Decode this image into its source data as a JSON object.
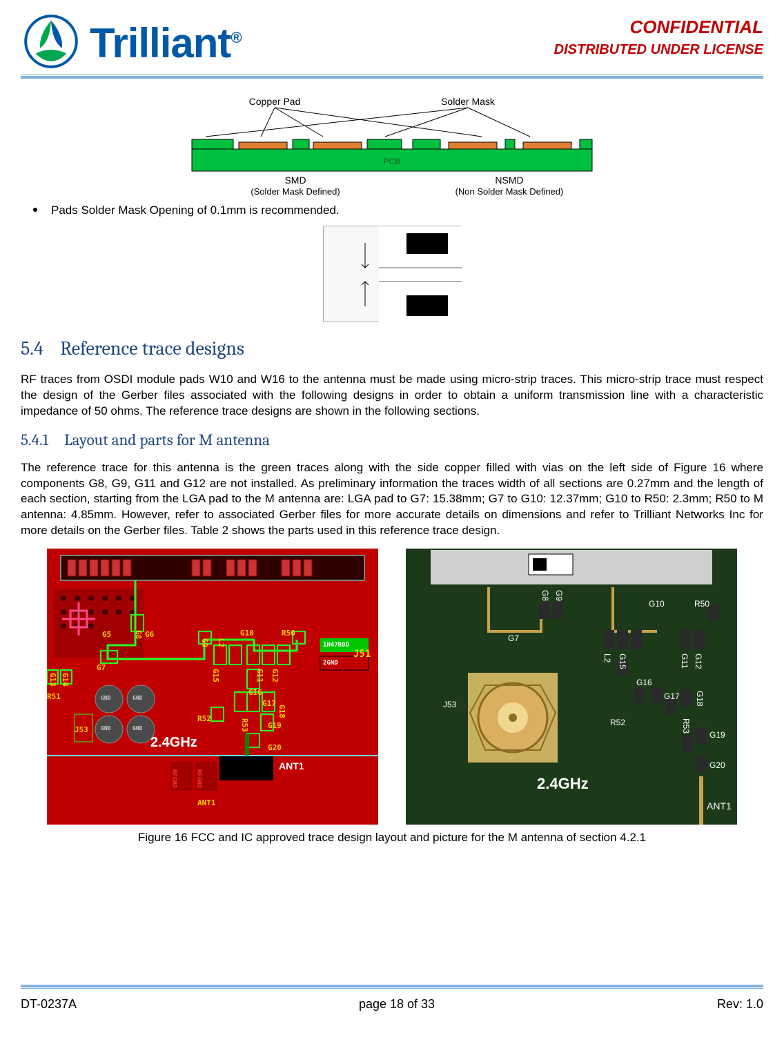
{
  "header": {
    "logo_text": "Trilliant",
    "logo_reg": "®",
    "confidential_line1": "CONFIDENTIAL",
    "confidential_line2": "DISTRIBUTED UNDER LICENSE"
  },
  "diagram1": {
    "label_copper_pad": "Copper Pad",
    "label_solder_mask": "Solder Mask",
    "label_pcb": "PCB",
    "label_smd": "SMD",
    "label_smd_sub": "(Solder Mask Defined)",
    "label_nsmd": "NSMD",
    "label_nsmd_sub": "(Non Solder Mask Defined)"
  },
  "bullet1": "Pads Solder Mask Opening of 0.1mm is recommended.",
  "section_5_4": {
    "num": "5.4",
    "title": "Reference trace designs",
    "para": "RF traces from OSDI module pads W10 and W16 to the antenna must be made using micro-strip traces.  This micro-strip trace must respect the design of the Gerber files associated with the following designs in order to obtain a uniform transmission line with a characteristic impedance of 50 ohms.  The reference trace designs are shown in the following sections."
  },
  "section_5_4_1": {
    "num": "5.4.1",
    "title": "Layout and parts for M antenna",
    "para": "The reference trace for this antenna is the green traces along with the side copper filled with vias on the left side of Figure 16 where components G8, G9, G11 and G12 are not installed.  As preliminary information the traces width of all sections are 0.27mm and the length of each section, starting from the LGA pad to the M antenna are: LGA pad to G7: 15.38mm; G7 to G10: 12.37mm; G10 to R50: 2.3mm; R50 to M antenna: 4.85mm.  However, refer to associated Gerber files for more accurate details on dimensions and refer to Trilliant Networks Inc for more details on the Gerber files.  Table 2 shows the parts used in this reference trace design."
  },
  "figure16_caption": "Figure 16  FCC and IC approved trace design layout and picture for the M antenna of section 4.2.1",
  "pcb_layout": {
    "freq_label": "2.4GHz",
    "ant_label_top": "ANT1",
    "ant_label_bottom": "ANT1",
    "j51": "J51",
    "j53": "J53",
    "g5": "G5",
    "g6": "G6",
    "g7": "G7",
    "g8": "G8",
    "g9": "G9",
    "g10": "G10",
    "g11": "G11",
    "g12": "G12",
    "g13": "G13",
    "g14": "G14",
    "g15": "G15",
    "g16": "G16",
    "g17": "G17",
    "g18": "G18",
    "g19": "G19",
    "g20": "G20",
    "r50": "R50",
    "r51": "R51",
    "r52": "R52",
    "r53": "R53",
    "l2": "L2",
    "gnd1": "GND",
    "gnd2": "GND",
    "gnd3": "GND",
    "gnd4": "GND",
    "rfgnd1": "RFGND",
    "rfgnd2": "RFGND",
    "lbl_1n47r0d": "1N47R0D",
    "lbl_2gnd": "2GND"
  },
  "pcb_photo": {
    "freq_label": "2.4GHz",
    "ant1": "ANT1",
    "j53": "J53",
    "g7": "G7",
    "g8": "G8",
    "g9": "G9",
    "g10": "G10",
    "g11": "G11",
    "g12": "G12",
    "g15": "G15",
    "g16": "G16",
    "g17": "G17",
    "g18": "G18",
    "g19": "G19",
    "g20": "G20",
    "r50": "R50",
    "r52": "R52",
    "r53": "R53",
    "l2": "L2"
  },
  "footer": {
    "doc_id": "DT-0237A",
    "page": "page 18 of 33",
    "rev": "Rev: 1.0"
  }
}
